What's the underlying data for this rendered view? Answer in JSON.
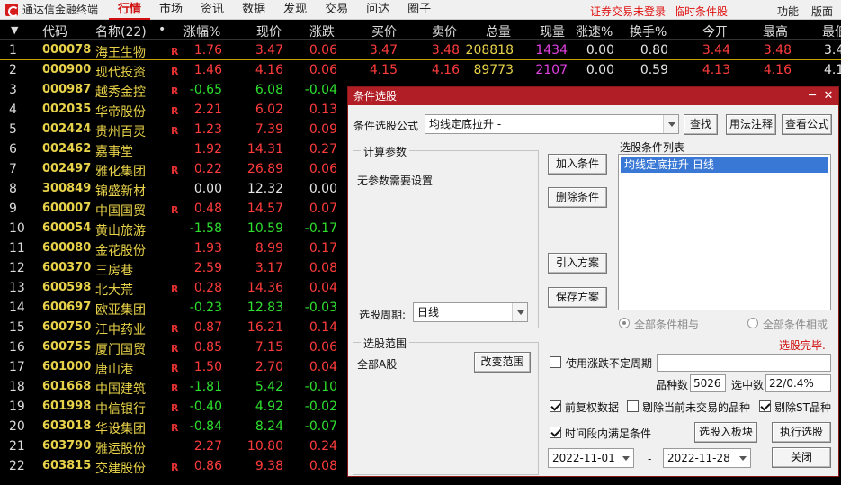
{
  "app": {
    "title": "通达信金融终端"
  },
  "menu": [
    "行情",
    "市场",
    "资讯",
    "数据",
    "发现",
    "交易",
    "问达",
    "圈子"
  ],
  "top_status": {
    "login": "证券交易未登录",
    "temp": "临时条件股"
  },
  "top_right": {
    "func": "功能",
    "layout": "版面"
  },
  "columns": {
    "code": "代码",
    "name": "名称(22)",
    "dot": "•",
    "change_pct": "涨幅%",
    "price": "现价",
    "change": "涨跌",
    "bid": "买价",
    "ask": "卖价",
    "volume": "总量",
    "cur_vol": "现量",
    "speed": "涨速%",
    "turnover": "换手%",
    "open": "今开",
    "high": "最高",
    "last": "最低"
  },
  "rows": [
    {
      "idx": "1",
      "code": "000078",
      "name": "海王生物",
      "r": "R",
      "pct": "1.76",
      "price": "3.47",
      "chg": "0.06",
      "bid": "3.47",
      "ask": "3.48",
      "vol": "208818",
      "cur": "1434",
      "speed": "0.00",
      "turn": "0.80",
      "open": "3.44",
      "high": "3.48",
      "low": "3.4",
      "dir": "up"
    },
    {
      "idx": "2",
      "code": "000900",
      "name": "现代投资",
      "r": "R",
      "pct": "1.46",
      "price": "4.16",
      "chg": "0.06",
      "bid": "4.15",
      "ask": "4.16",
      "vol": "89773",
      "cur": "2107",
      "speed": "0.00",
      "turn": "0.59",
      "open": "4.13",
      "high": "4.16",
      "low": "4.1",
      "dir": "up"
    },
    {
      "idx": "3",
      "code": "000987",
      "name": "越秀金控",
      "r": "R",
      "pct": "-0.65",
      "price": "6.08",
      "chg": "-0.04",
      "dir": "down"
    },
    {
      "idx": "4",
      "code": "002035",
      "name": "华帝股份",
      "r": "R",
      "pct": "2.21",
      "price": "6.02",
      "chg": "0.13",
      "dir": "up"
    },
    {
      "idx": "5",
      "code": "002424",
      "name": "贵州百灵",
      "r": "R",
      "pct": "1.23",
      "price": "7.39",
      "chg": "0.09",
      "dir": "up"
    },
    {
      "idx": "6",
      "code": "002462",
      "name": "嘉事堂",
      "r": "",
      "pct": "1.92",
      "price": "14.31",
      "chg": "0.27",
      "dir": "up"
    },
    {
      "idx": "7",
      "code": "002497",
      "name": "雅化集团",
      "r": "R",
      "pct": "0.22",
      "price": "26.89",
      "chg": "0.06",
      "dir": "up"
    },
    {
      "idx": "8",
      "code": "300849",
      "name": "锦盛新材",
      "r": "",
      "pct": "0.00",
      "price": "12.32",
      "chg": "0.00",
      "dir": "flat"
    },
    {
      "idx": "9",
      "code": "600007",
      "name": "中国国贸",
      "r": "R",
      "pct": "0.48",
      "price": "14.57",
      "chg": "0.07",
      "dir": "up"
    },
    {
      "idx": "10",
      "code": "600054",
      "name": "黄山旅游",
      "r": "",
      "pct": "-1.58",
      "price": "10.59",
      "chg": "-0.17",
      "dir": "down"
    },
    {
      "idx": "11",
      "code": "600080",
      "name": "金花股份",
      "r": "",
      "pct": "1.93",
      "price": "8.99",
      "chg": "0.17",
      "dir": "up"
    },
    {
      "idx": "12",
      "code": "600370",
      "name": "三房巷",
      "r": "",
      "pct": "2.59",
      "price": "3.17",
      "chg": "0.08",
      "dir": "up"
    },
    {
      "idx": "13",
      "code": "600598",
      "name": "北大荒",
      "r": "R",
      "pct": "0.28",
      "price": "14.36",
      "chg": "0.04",
      "dir": "up"
    },
    {
      "idx": "14",
      "code": "600697",
      "name": "欧亚集团",
      "r": "",
      "pct": "-0.23",
      "price": "12.83",
      "chg": "-0.03",
      "dir": "down"
    },
    {
      "idx": "15",
      "code": "600750",
      "name": "江中药业",
      "r": "R",
      "pct": "0.87",
      "price": "16.21",
      "chg": "0.14",
      "dir": "up"
    },
    {
      "idx": "16",
      "code": "600755",
      "name": "厦门国贸",
      "r": "R",
      "pct": "0.85",
      "price": "7.15",
      "chg": "0.06",
      "dir": "up"
    },
    {
      "idx": "17",
      "code": "601000",
      "name": "唐山港",
      "r": "R",
      "pct": "1.50",
      "price": "2.70",
      "chg": "0.04",
      "dir": "up"
    },
    {
      "idx": "18",
      "code": "601668",
      "name": "中国建筑",
      "r": "R",
      "pct": "-1.81",
      "price": "5.42",
      "chg": "-0.10",
      "dir": "down"
    },
    {
      "idx": "19",
      "code": "601998",
      "name": "中信银行",
      "r": "R",
      "pct": "-0.40",
      "price": "4.92",
      "chg": "-0.02",
      "dir": "down"
    },
    {
      "idx": "20",
      "code": "603018",
      "name": "华设集团",
      "r": "R",
      "pct": "-0.84",
      "price": "8.24",
      "chg": "-0.07",
      "dir": "down"
    },
    {
      "idx": "21",
      "code": "603790",
      "name": "雅运股份",
      "r": "",
      "pct": "2.27",
      "price": "10.80",
      "chg": "0.24",
      "dir": "up"
    },
    {
      "idx": "22",
      "code": "603815",
      "name": "交建股份",
      "r": "R",
      "pct": "0.86",
      "price": "9.38",
      "chg": "0.08",
      "dir": "up"
    }
  ],
  "dialog": {
    "title": "条件选股",
    "formula_label": "条件选股公式",
    "formula_value": "均线定底拉升 -",
    "btn_find": "查找",
    "btn_usage": "用法注释",
    "btn_view": "查看公式",
    "calc_params_title": "计算参数",
    "no_params": "无参数需要设置",
    "period_label": "选股周期:",
    "period_value": "日线",
    "btn_add": "加入条件",
    "btn_delete": "删除条件",
    "btn_import": "引入方案",
    "btn_save": "保存方案",
    "list_title": "选股条件列表",
    "list_items": [
      "均线定底拉升  日线"
    ],
    "radio_and": "全部条件相与",
    "radio_or": "全部条件相或",
    "status": "选股完毕.",
    "range_title": "选股范围",
    "range_value": "全部A股",
    "btn_change_range": "改变范围",
    "use_period_label": "使用涨跌不定周期",
    "count_label": "品种数",
    "count_value": "5026",
    "selected_label": "选中数",
    "selected_value": "22/0.4%",
    "cb_restore": "前复权数据",
    "cb_exclude_untraded": "剔除当前未交易的品种",
    "cb_exclude_st": "剔除ST品种",
    "cb_time_range": "时间段内满足条件",
    "btn_to_block": "选股入板块",
    "btn_run": "执行选股",
    "date_from": "2022-11-01",
    "date_sep": "-",
    "date_to": "2022-11-28",
    "btn_close": "关闭"
  }
}
